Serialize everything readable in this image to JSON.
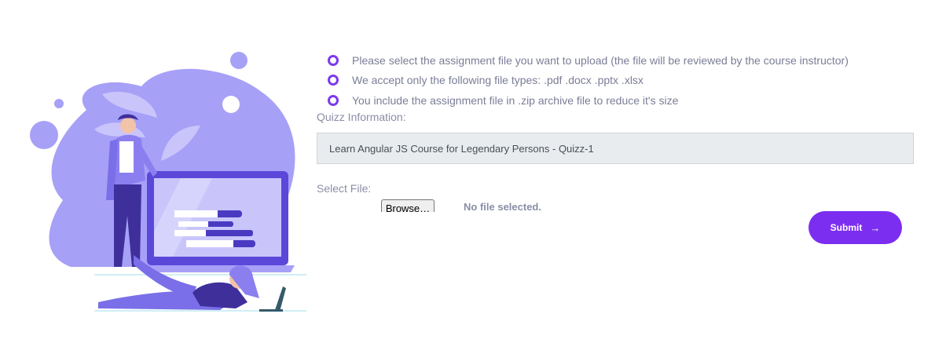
{
  "info": {
    "items": [
      "Please select the assignment file you want to upload (the file will be reviewed by the course instructor)",
      "We accept only the following file types: .pdf .docx .pptx .xlsx",
      "You include the assignment file in .zip archive file to reduce it's size"
    ]
  },
  "quiz": {
    "label": "Quizz Information:",
    "value": "Learn Angular JS Course for Legendary Persons - Quizz-1"
  },
  "file": {
    "label": "Select File:",
    "browse_label": "Browse…",
    "status": "No file selected."
  },
  "submit": {
    "label": "Submit",
    "icon": "arrow-right-icon"
  },
  "colors": {
    "accent": "#7c2ef0",
    "illustration": "#a49cf4"
  }
}
